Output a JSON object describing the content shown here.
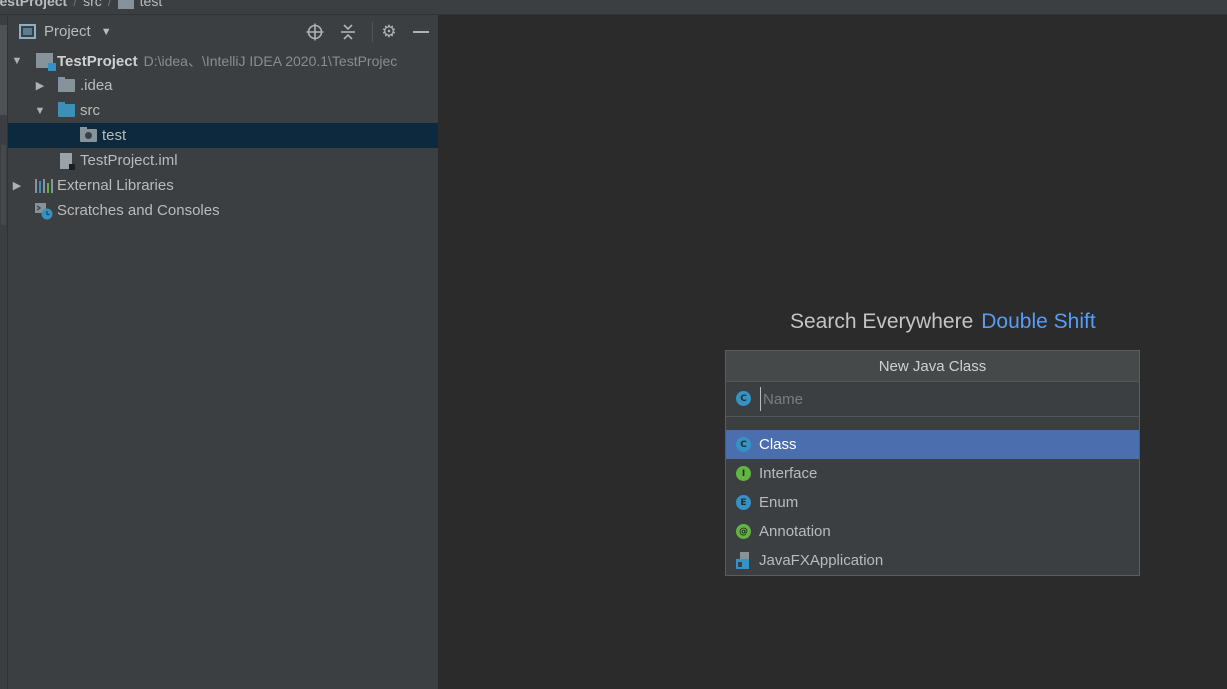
{
  "breadcrumb": {
    "project": "TestProject",
    "items": [
      "src",
      "test"
    ]
  },
  "project_panel": {
    "title": "Project",
    "tree": [
      {
        "label": "TestProject",
        "path": "D:\\idea、\\IntelliJ IDEA 2020.1\\TestProjec"
      },
      {
        "label": ".idea"
      },
      {
        "label": "src"
      },
      {
        "label": "test"
      },
      {
        "label": "TestProject.iml"
      },
      {
        "label": "External Libraries"
      },
      {
        "label": "Scratches and Consoles"
      }
    ]
  },
  "editor": {
    "hint_label": "Search Everywhere",
    "hint_key": "Double Shift"
  },
  "new_class_popup": {
    "title": "New Java Class",
    "name_placeholder": "Name",
    "kinds": [
      {
        "label": "Class",
        "icon_letter": "C"
      },
      {
        "label": "Interface",
        "icon_letter": "I"
      },
      {
        "label": "Enum",
        "icon_letter": "E"
      },
      {
        "label": "Annotation",
        "icon_letter": "@"
      },
      {
        "label": "JavaFXApplication"
      }
    ]
  },
  "colors": {
    "selection": "#4b6eaf",
    "tree_selection": "#0d293e",
    "link": "#589df6"
  }
}
